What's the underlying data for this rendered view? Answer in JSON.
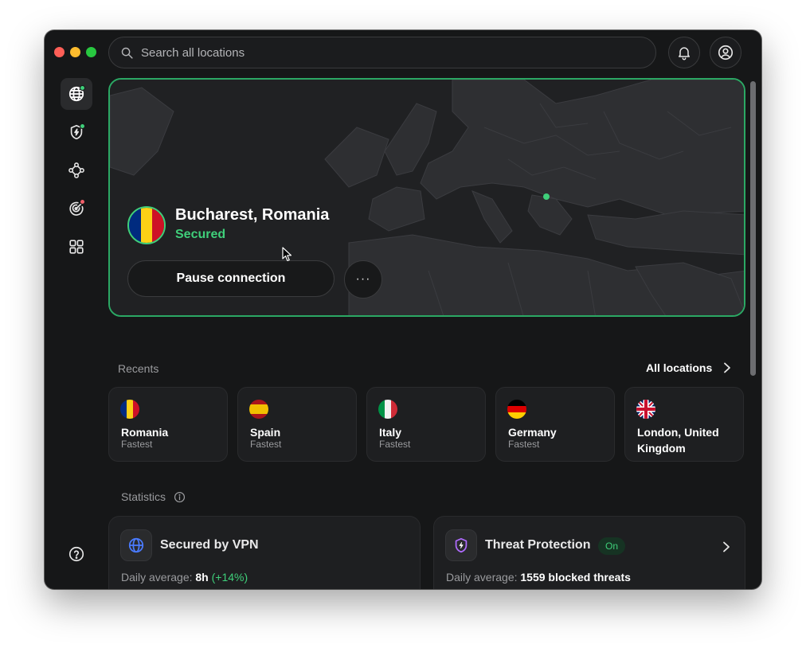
{
  "search": {
    "placeholder": "Search all locations"
  },
  "sidebar": {
    "items": [
      {
        "name": "globe-icon",
        "active": true,
        "badge": "green"
      },
      {
        "name": "threat-shield-icon",
        "badge": "green"
      },
      {
        "name": "meshnet-icon"
      },
      {
        "name": "dark-web-monitor-icon",
        "badge": "red"
      },
      {
        "name": "apps-grid-icon"
      }
    ],
    "help": "help-icon"
  },
  "connection": {
    "location": "Bucharest, Romania",
    "status": "Secured",
    "pause_label": "Pause connection",
    "more_label": "···",
    "flag_colors": [
      "#002B7F",
      "#FCD116",
      "#CE1126"
    ]
  },
  "recents": {
    "label": "Recents",
    "all_label": "All locations",
    "items": [
      {
        "name": "Romania",
        "sub": "Fastest"
      },
      {
        "name": "Spain",
        "sub": "Fastest"
      },
      {
        "name": "Italy",
        "sub": "Fastest"
      },
      {
        "name": "Germany",
        "sub": "Fastest"
      },
      {
        "name": "London, United Kingdom",
        "sub": ""
      }
    ]
  },
  "statistics": {
    "label": "Statistics",
    "vpn": {
      "title": "Secured by VPN",
      "sub_prefix": "Daily average:",
      "value": "8h",
      "change": "(+14%)"
    },
    "threat": {
      "title": "Threat Protection",
      "badge": "On",
      "sub_prefix": "Daily average:",
      "value": "1559 blocked threats"
    }
  },
  "colors": {
    "accent": "#3fcf7a",
    "background": "#161718",
    "card": "#1e1f21"
  }
}
